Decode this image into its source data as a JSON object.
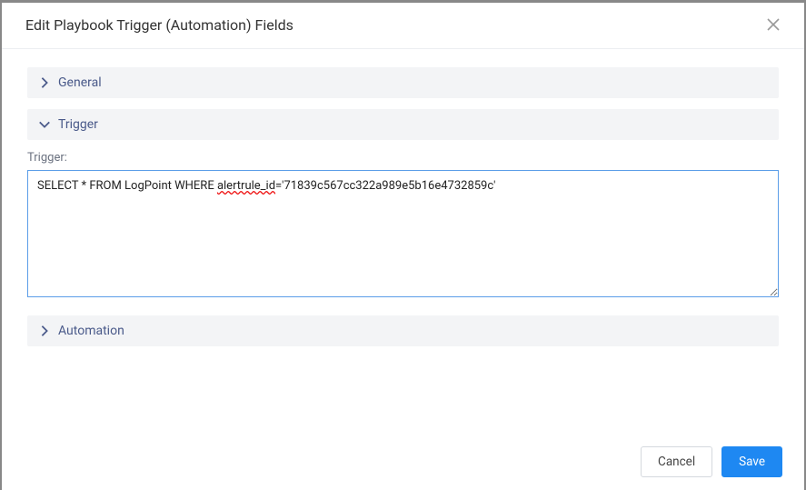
{
  "header": {
    "title": "Edit Playbook Trigger (Automation) Fields"
  },
  "sections": {
    "general": {
      "label": "General"
    },
    "trigger": {
      "label": "Trigger"
    },
    "automation": {
      "label": "Automation"
    }
  },
  "triggerField": {
    "label": "Trigger:",
    "prefix": "SELECT * FROM LogPoint WHERE ",
    "underlined": "alertrule_id",
    "suffix": "='71839c567cc322a989e5b16e4732859c'",
    "full": "SELECT * FROM LogPoint WHERE alertrule_id='71839c567cc322a989e5b16e4732859c'"
  },
  "footer": {
    "cancel": "Cancel",
    "save": "Save"
  }
}
